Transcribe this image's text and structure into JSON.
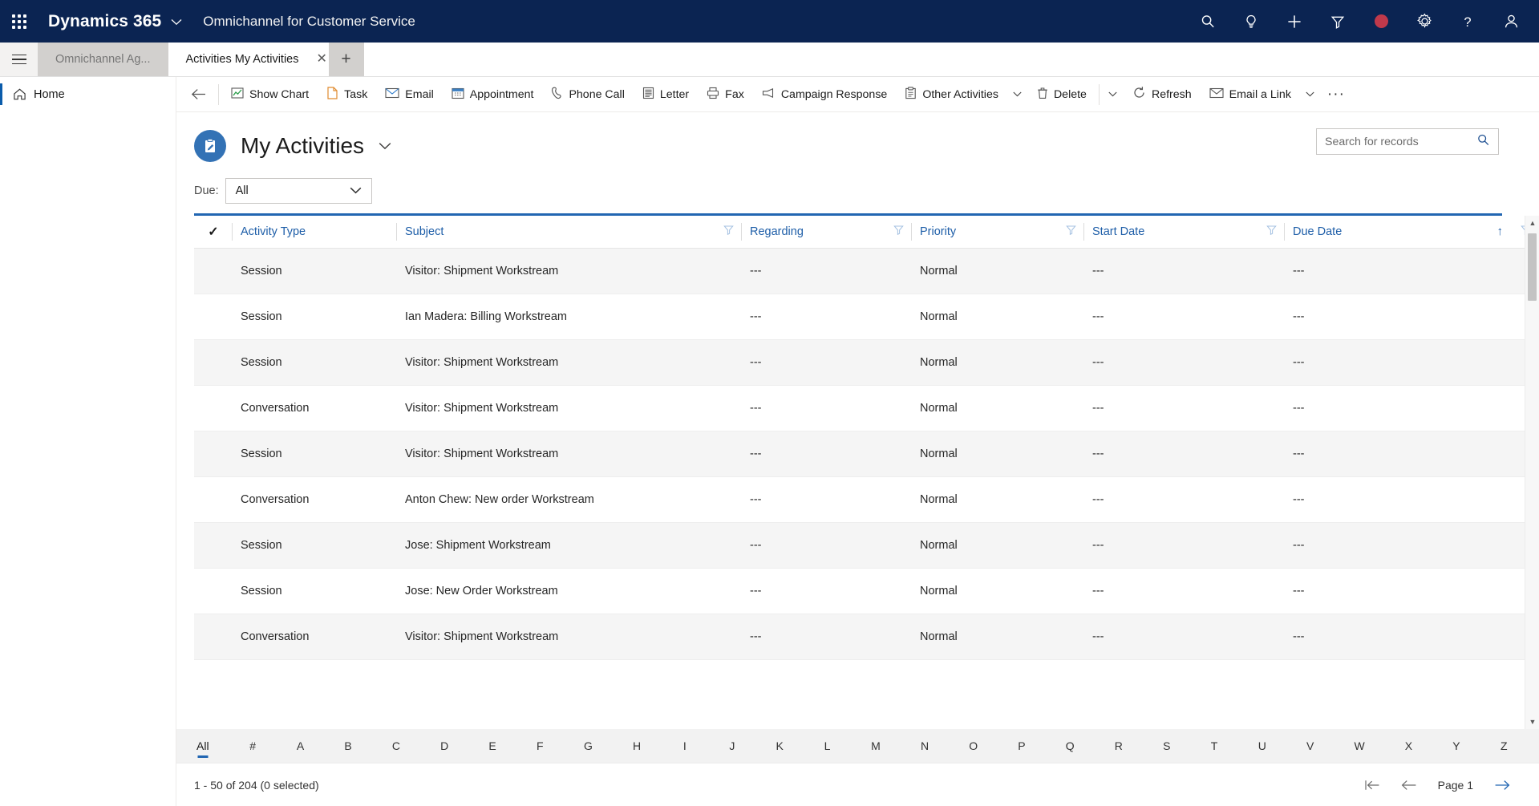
{
  "topbar": {
    "waffle_label": "app-launcher",
    "brand": "Dynamics 365",
    "app_name": "Omnichannel for Customer Service",
    "icons": [
      {
        "name": "search-icon",
        "label": "Search"
      },
      {
        "name": "lightbulb-icon",
        "label": "Insights"
      },
      {
        "name": "plus-icon",
        "label": "Quick create"
      },
      {
        "name": "filter-icon",
        "label": "Filter"
      },
      {
        "name": "presence-icon",
        "label": "Presence",
        "color": "#c0394b"
      },
      {
        "name": "gear-icon",
        "label": "Settings"
      },
      {
        "name": "help-icon",
        "label": "Help"
      },
      {
        "name": "user-avatar-icon",
        "label": "Account"
      }
    ]
  },
  "tabs": {
    "hamburger_label": "Site map",
    "items": [
      {
        "label": "Omnichannel Ag...",
        "active": false,
        "closable": false
      },
      {
        "label": "Activities My Activities",
        "active": true,
        "closable": true
      }
    ],
    "new_tab_label": "+",
    "close_label": "✕"
  },
  "sidenav": {
    "items": [
      {
        "label": "Home",
        "icon": "home-icon",
        "selected": true
      }
    ]
  },
  "commandbar": {
    "back_label": "Back",
    "buttons": [
      {
        "label": "Show Chart",
        "icon": "chart-icon",
        "caret": false
      },
      {
        "label": "Task",
        "icon": "task-icon",
        "caret": false
      },
      {
        "label": "Email",
        "icon": "email-icon",
        "caret": false
      },
      {
        "label": "Appointment",
        "icon": "appointment-icon",
        "caret": false
      },
      {
        "label": "Phone Call",
        "icon": "phone-icon",
        "caret": false
      },
      {
        "label": "Letter",
        "icon": "letter-icon",
        "caret": false
      },
      {
        "label": "Fax",
        "icon": "fax-icon",
        "caret": false
      },
      {
        "label": "Campaign Response",
        "icon": "campaign-icon",
        "caret": false
      },
      {
        "label": "Other Activities",
        "icon": "other-activities-icon",
        "caret": true
      },
      {
        "label": "Delete",
        "icon": "delete-icon",
        "caret": true
      },
      {
        "label": "Refresh",
        "icon": "refresh-icon",
        "caret": false
      },
      {
        "label": "Email a Link",
        "icon": "email-link-icon",
        "caret": true
      }
    ],
    "overflow_label": "···"
  },
  "page": {
    "icon": "activities-clipboard-icon",
    "title": "My Activities",
    "title_caret": "⌄",
    "accent_color": "#3372b5"
  },
  "search": {
    "placeholder": "Search for records",
    "value": "",
    "icon": "search-icon"
  },
  "due_filter": {
    "label": "Due:",
    "value": "All",
    "caret": "⌄"
  },
  "grid": {
    "select_all_icon": "checkmark-icon",
    "columns": [
      {
        "key": "activity_type",
        "label": "Activity Type",
        "filter": false,
        "sort": null
      },
      {
        "key": "subject",
        "label": "Subject",
        "filter": true,
        "sort": null
      },
      {
        "key": "regarding",
        "label": "Regarding",
        "filter": true,
        "sort": null
      },
      {
        "key": "priority",
        "label": "Priority",
        "filter": true,
        "sort": null
      },
      {
        "key": "start_date",
        "label": "Start Date",
        "filter": true,
        "sort": null
      },
      {
        "key": "due_date",
        "label": "Due Date",
        "filter": true,
        "sort": "asc"
      }
    ],
    "sort_arrow": "↑",
    "rows": [
      {
        "activity_type": "Session",
        "subject": "Visitor: Shipment Workstream",
        "regarding": "---",
        "priority": "Normal",
        "start_date": "---",
        "due_date": "---"
      },
      {
        "activity_type": "Session",
        "subject": "Ian Madera: Billing Workstream",
        "regarding": "---",
        "priority": "Normal",
        "start_date": "---",
        "due_date": "---"
      },
      {
        "activity_type": "Session",
        "subject": "Visitor: Shipment Workstream",
        "regarding": "---",
        "priority": "Normal",
        "start_date": "---",
        "due_date": "---"
      },
      {
        "activity_type": "Conversation",
        "subject": "Visitor: Shipment Workstream",
        "regarding": "---",
        "priority": "Normal",
        "start_date": "---",
        "due_date": "---"
      },
      {
        "activity_type": "Session",
        "subject": "Visitor: Shipment Workstream",
        "regarding": "---",
        "priority": "Normal",
        "start_date": "---",
        "due_date": "---"
      },
      {
        "activity_type": "Conversation",
        "subject": "Anton Chew: New order Workstream",
        "regarding": "---",
        "priority": "Normal",
        "start_date": "---",
        "due_date": "---"
      },
      {
        "activity_type": "Session",
        "subject": "Jose: Shipment Workstream",
        "regarding": "---",
        "priority": "Normal",
        "start_date": "---",
        "due_date": "---"
      },
      {
        "activity_type": "Session",
        "subject": "Jose: New Order Workstream",
        "regarding": "---",
        "priority": "Normal",
        "start_date": "---",
        "due_date": "---"
      },
      {
        "activity_type": "Conversation",
        "subject": "Visitor: Shipment Workstream",
        "regarding": "---",
        "priority": "Normal",
        "start_date": "---",
        "due_date": "---"
      }
    ]
  },
  "alpha_bar": {
    "selected": "All",
    "items": [
      "All",
      "#",
      "A",
      "B",
      "C",
      "D",
      "E",
      "F",
      "G",
      "H",
      "I",
      "J",
      "K",
      "L",
      "M",
      "N",
      "O",
      "P",
      "Q",
      "R",
      "S",
      "T",
      "U",
      "V",
      "W",
      "X",
      "Y",
      "Z"
    ]
  },
  "footer": {
    "count_text": "1 - 50 of 204 (0 selected)",
    "page_label": "Page 1",
    "first_icon": "first-page-icon",
    "prev_icon": "previous-page-icon",
    "next_icon": "next-page-icon"
  }
}
